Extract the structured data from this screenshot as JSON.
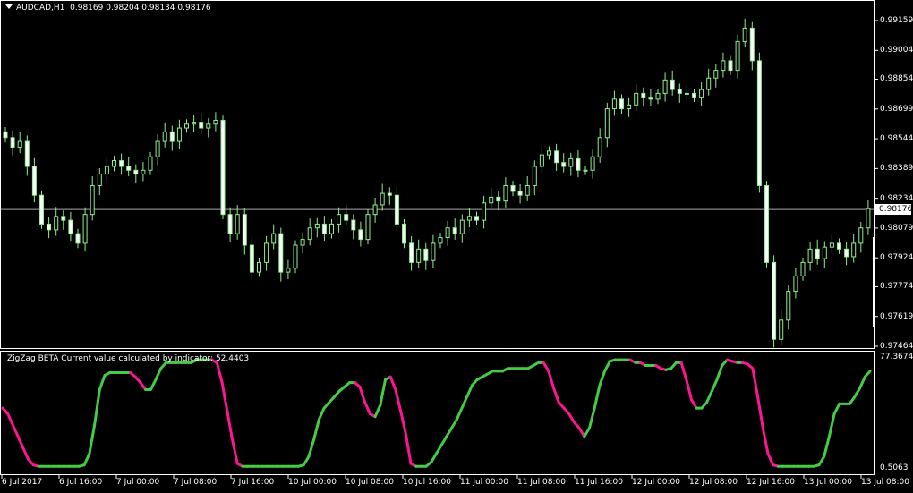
{
  "header": {
    "symbol_tf": "AUDCAD,H1",
    "ohlc": "0.98169 0.98204 0.98134 0.98176"
  },
  "main_axis": {
    "ticks": [
      "0.99159",
      "0.99004",
      "0.98854",
      "0.98699",
      "0.98544",
      "0.98389",
      "0.98234",
      "0.98079",
      "0.97924",
      "0.97774",
      "0.97619",
      "0.97464"
    ],
    "tick_values": [
      0.99159,
      0.99004,
      0.98854,
      0.98699,
      0.98544,
      0.98389,
      0.98234,
      0.98079,
      0.97924,
      0.97774,
      0.97619,
      0.97464
    ],
    "current_price": "0.98176",
    "current_value": 0.98176
  },
  "indicator": {
    "label": "ZigZag BETA Current value calculated by indicator: 52.4403",
    "max_label": "77.3674",
    "min_label": "0.5063"
  },
  "x_axis": {
    "labels": [
      "6 Jul 2017",
      "6 Jul 16:00",
      "7 Jul 00:00",
      "7 Jul 08:00",
      "7 Jul 16:00",
      "10 Jul 00:00",
      "10 Jul 08:00",
      "10 Jul 16:00",
      "11 Jul 00:00",
      "11 Jul 08:00",
      "11 Jul 16:00",
      "12 Jul 00:00",
      "12 Jul 08:00",
      "12 Jul 16:00",
      "13 Jul 00:00",
      "13 Jul 08:00"
    ]
  },
  "colors": {
    "background": "#000000",
    "candle": "#90ee90",
    "up_line": "#44cc44",
    "down_line": "#ff1493"
  },
  "chart_data": [
    {
      "type": "candlestick",
      "title": "AUDCAD,H1",
      "ylim": [
        0.97464,
        0.99159
      ],
      "closes": [
        0.9855,
        0.985,
        0.9853,
        0.984,
        0.9825,
        0.981,
        0.9807,
        0.9814,
        0.9812,
        0.9805,
        0.98,
        0.9815,
        0.983,
        0.9836,
        0.984,
        0.9843,
        0.984,
        0.9838,
        0.9836,
        0.9838,
        0.9845,
        0.9853,
        0.9858,
        0.9853,
        0.986,
        0.9862,
        0.9863,
        0.986,
        0.9862,
        0.9864,
        0.9815,
        0.9805,
        0.9815,
        0.9799,
        0.9785,
        0.979,
        0.98,
        0.9805,
        0.9785,
        0.9787,
        0.9799,
        0.9802,
        0.9808,
        0.981,
        0.9805,
        0.981,
        0.9815,
        0.9812,
        0.9807,
        0.9802,
        0.9815,
        0.982,
        0.9826,
        0.9825,
        0.981,
        0.98,
        0.979,
        0.9797,
        0.9791,
        0.98,
        0.9803,
        0.9808,
        0.9805,
        0.9812,
        0.9814,
        0.9812,
        0.9821,
        0.9824,
        0.9822,
        0.983,
        0.9827,
        0.9825,
        0.983,
        0.984,
        0.9846,
        0.9848,
        0.9842,
        0.984,
        0.9844,
        0.9838,
        0.9838,
        0.9845,
        0.9855,
        0.987,
        0.9875,
        0.987,
        0.9872,
        0.9878,
        0.9876,
        0.9875,
        0.9878,
        0.9885,
        0.988,
        0.9878,
        0.9878,
        0.9876,
        0.988,
        0.9886,
        0.989,
        0.9895,
        0.989,
        0.9905,
        0.9912,
        0.9895,
        0.983,
        0.979,
        0.975,
        0.976,
        0.9775,
        0.9783,
        0.979,
        0.9797,
        0.9792,
        0.9798,
        0.98,
        0.9797,
        0.9793,
        0.98,
        0.9808,
        0.9818
      ]
    },
    {
      "type": "line",
      "title": "ZigZag BETA",
      "ylim": [
        0.5063,
        77.3674
      ],
      "values": [
        42,
        38,
        30,
        22,
        14,
        6,
        2,
        1,
        1,
        1,
        1,
        1,
        1,
        1,
        1,
        1,
        2,
        10,
        30,
        55,
        65,
        67,
        67,
        67,
        67,
        67,
        64,
        60,
        55,
        55,
        62,
        70,
        74,
        74,
        74,
        74,
        74,
        74,
        76,
        76,
        76,
        76,
        74,
        60,
        40,
        20,
        3,
        1,
        1,
        1,
        1,
        1,
        1,
        1,
        1,
        1,
        1,
        1,
        1,
        2,
        8,
        20,
        34,
        42,
        46,
        50,
        54,
        57,
        60,
        60,
        57,
        46,
        38,
        36,
        44,
        62,
        64,
        55,
        40,
        24,
        3,
        1,
        1,
        1,
        4,
        10,
        16,
        22,
        28,
        34,
        42,
        50,
        58,
        62,
        64,
        66,
        68,
        68,
        68,
        70,
        70,
        70,
        70,
        70,
        72,
        74,
        74,
        68,
        56,
        46,
        42,
        38,
        32,
        28,
        22,
        28,
        42,
        58,
        68,
        75,
        76,
        76,
        76,
        76,
        74,
        74,
        72,
        72,
        72,
        70,
        69,
        70,
        74,
        74,
        62,
        48,
        42,
        42,
        46,
        54,
        62,
        72,
        76,
        75,
        74,
        74,
        73,
        70,
        50,
        28,
        10,
        2,
        1,
        1,
        1,
        1,
        1,
        1,
        1,
        1,
        2,
        8,
        22,
        38,
        45,
        45,
        45,
        50,
        56,
        64,
        68
      ]
    }
  ]
}
